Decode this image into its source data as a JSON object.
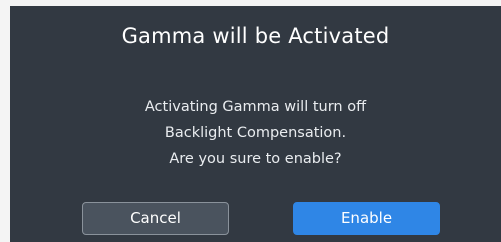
{
  "dialog": {
    "title": "Gamma will be Activated",
    "message_lines": [
      "Activating Gamma will turn off",
      "Backlight Compensation.",
      "Are you sure to enable?"
    ],
    "cancel_label": "Cancel",
    "enable_label": "Enable"
  },
  "colors": {
    "dialog_background": "#323942",
    "cancel_background": "#4a535e",
    "enable_background": "#2f86e6",
    "text": "#ffffff"
  }
}
